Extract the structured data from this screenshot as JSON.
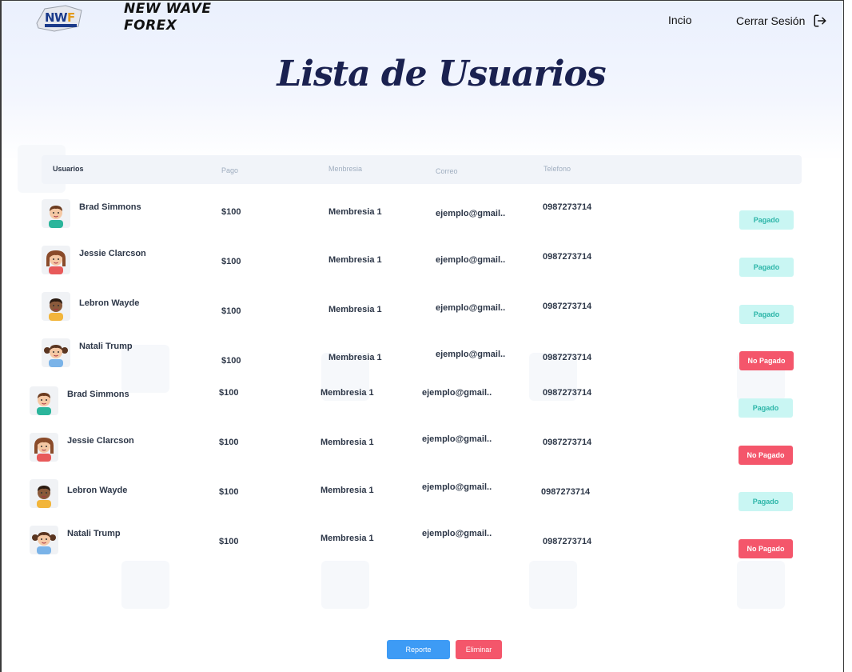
{
  "header": {
    "brand_line1": "NEW WAVE",
    "brand_line2": "FOREX",
    "logo_text": "NWF",
    "nav_home": "Incio",
    "nav_logout": "Cerrar Sesión"
  },
  "page": {
    "title": "Lista de Usuarios"
  },
  "table": {
    "columns": [
      "Usuarios",
      "Pago",
      "Menbresia",
      "Correo",
      "Telefono"
    ],
    "rows": [
      {
        "name": "Brad Simmons",
        "payment": "$100",
        "membership": "Membresia 1",
        "email": "ejemplo@gmail..",
        "phone": "0987273714",
        "status": "Pagado",
        "avatar": "boy-avatar"
      },
      {
        "name": "Jessie Clarcson",
        "payment": "$100",
        "membership": "Membresia 1",
        "email": "ejemplo@gmail..",
        "phone": "0987273714",
        "status": "Pagado",
        "avatar": "girl-avatar"
      },
      {
        "name": "Lebron Wayde",
        "payment": "$100",
        "membership": "Membresia 1",
        "email": "ejemplo@gmail..",
        "phone": "0987273714",
        "status": "Pagado",
        "avatar": "boy-dark-avatar"
      },
      {
        "name": "Natali Trump",
        "payment": "$100",
        "membership": "Membresia 1",
        "email": "ejemplo@gmail..",
        "phone": "0987273714",
        "status": "No Pagado",
        "avatar": "girl-pigtails-avatar"
      },
      {
        "name": "Brad Simmons",
        "payment": "$100",
        "membership": "Membresia 1",
        "email": "ejemplo@gmail..",
        "phone": "0987273714",
        "status": "Pagado",
        "avatar": "boy-avatar"
      },
      {
        "name": "Jessie Clarcson",
        "payment": "$100",
        "membership": "Membresia 1",
        "email": "ejemplo@gmail..",
        "phone": "0987273714",
        "status": "No Pagado",
        "avatar": "girl-avatar"
      },
      {
        "name": "Lebron Wayde",
        "payment": "$100",
        "membership": "Membresia 1",
        "email": "ejemplo@gmail..",
        "phone": "0987273714",
        "status": "Pagado",
        "avatar": "boy-dark-avatar"
      },
      {
        "name": "Natali Trump",
        "payment": "$100",
        "membership": "Membresia 1",
        "email": "ejemplo@gmail..",
        "phone": "0987273714",
        "status": "No Pagado",
        "avatar": "girl-pigtails-avatar"
      }
    ]
  },
  "actions": {
    "report_label": "Reporte",
    "delete_label": "Eliminar"
  },
  "colors": {
    "title": "#1a2150",
    "paid_bg": "#c9f6f3",
    "paid_text": "#2cb5a8",
    "unpaid_bg": "#f4566b",
    "report_btn": "#3d9bf5",
    "delete_btn": "#f4566b"
  },
  "icons": {
    "logout": "logout-icon",
    "logo": "nwf-logo-icon"
  }
}
